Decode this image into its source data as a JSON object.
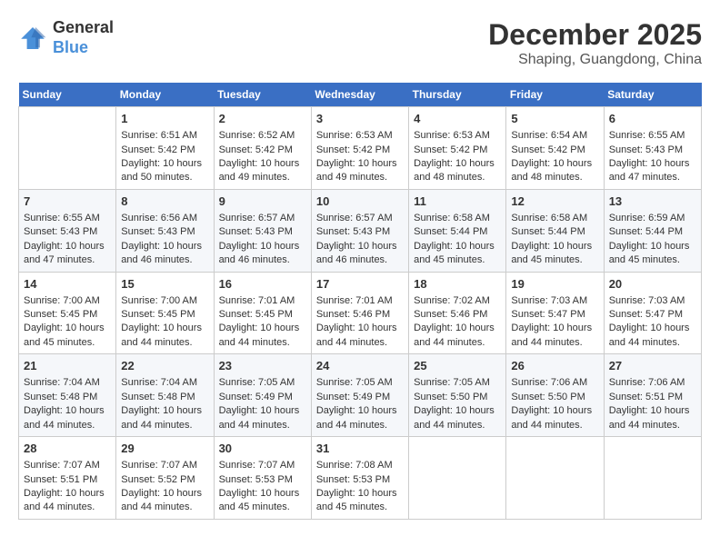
{
  "logo": {
    "line1": "General",
    "line2": "Blue"
  },
  "title": "December 2025",
  "subtitle": "Shaping, Guangdong, China",
  "days_header": [
    "Sunday",
    "Monday",
    "Tuesday",
    "Wednesday",
    "Thursday",
    "Friday",
    "Saturday"
  ],
  "weeks": [
    [
      {
        "day": "",
        "info": ""
      },
      {
        "day": "1",
        "info": "Sunrise: 6:51 AM\nSunset: 5:42 PM\nDaylight: 10 hours\nand 50 minutes."
      },
      {
        "day": "2",
        "info": "Sunrise: 6:52 AM\nSunset: 5:42 PM\nDaylight: 10 hours\nand 49 minutes."
      },
      {
        "day": "3",
        "info": "Sunrise: 6:53 AM\nSunset: 5:42 PM\nDaylight: 10 hours\nand 49 minutes."
      },
      {
        "day": "4",
        "info": "Sunrise: 6:53 AM\nSunset: 5:42 PM\nDaylight: 10 hours\nand 48 minutes."
      },
      {
        "day": "5",
        "info": "Sunrise: 6:54 AM\nSunset: 5:42 PM\nDaylight: 10 hours\nand 48 minutes."
      },
      {
        "day": "6",
        "info": "Sunrise: 6:55 AM\nSunset: 5:43 PM\nDaylight: 10 hours\nand 47 minutes."
      }
    ],
    [
      {
        "day": "7",
        "info": "Sunrise: 6:55 AM\nSunset: 5:43 PM\nDaylight: 10 hours\nand 47 minutes."
      },
      {
        "day": "8",
        "info": "Sunrise: 6:56 AM\nSunset: 5:43 PM\nDaylight: 10 hours\nand 46 minutes."
      },
      {
        "day": "9",
        "info": "Sunrise: 6:57 AM\nSunset: 5:43 PM\nDaylight: 10 hours\nand 46 minutes."
      },
      {
        "day": "10",
        "info": "Sunrise: 6:57 AM\nSunset: 5:43 PM\nDaylight: 10 hours\nand 46 minutes."
      },
      {
        "day": "11",
        "info": "Sunrise: 6:58 AM\nSunset: 5:44 PM\nDaylight: 10 hours\nand 45 minutes."
      },
      {
        "day": "12",
        "info": "Sunrise: 6:58 AM\nSunset: 5:44 PM\nDaylight: 10 hours\nand 45 minutes."
      },
      {
        "day": "13",
        "info": "Sunrise: 6:59 AM\nSunset: 5:44 PM\nDaylight: 10 hours\nand 45 minutes."
      }
    ],
    [
      {
        "day": "14",
        "info": "Sunrise: 7:00 AM\nSunset: 5:45 PM\nDaylight: 10 hours\nand 45 minutes."
      },
      {
        "day": "15",
        "info": "Sunrise: 7:00 AM\nSunset: 5:45 PM\nDaylight: 10 hours\nand 44 minutes."
      },
      {
        "day": "16",
        "info": "Sunrise: 7:01 AM\nSunset: 5:45 PM\nDaylight: 10 hours\nand 44 minutes."
      },
      {
        "day": "17",
        "info": "Sunrise: 7:01 AM\nSunset: 5:46 PM\nDaylight: 10 hours\nand 44 minutes."
      },
      {
        "day": "18",
        "info": "Sunrise: 7:02 AM\nSunset: 5:46 PM\nDaylight: 10 hours\nand 44 minutes."
      },
      {
        "day": "19",
        "info": "Sunrise: 7:03 AM\nSunset: 5:47 PM\nDaylight: 10 hours\nand 44 minutes."
      },
      {
        "day": "20",
        "info": "Sunrise: 7:03 AM\nSunset: 5:47 PM\nDaylight: 10 hours\nand 44 minutes."
      }
    ],
    [
      {
        "day": "21",
        "info": "Sunrise: 7:04 AM\nSunset: 5:48 PM\nDaylight: 10 hours\nand 44 minutes."
      },
      {
        "day": "22",
        "info": "Sunrise: 7:04 AM\nSunset: 5:48 PM\nDaylight: 10 hours\nand 44 minutes."
      },
      {
        "day": "23",
        "info": "Sunrise: 7:05 AM\nSunset: 5:49 PM\nDaylight: 10 hours\nand 44 minutes."
      },
      {
        "day": "24",
        "info": "Sunrise: 7:05 AM\nSunset: 5:49 PM\nDaylight: 10 hours\nand 44 minutes."
      },
      {
        "day": "25",
        "info": "Sunrise: 7:05 AM\nSunset: 5:50 PM\nDaylight: 10 hours\nand 44 minutes."
      },
      {
        "day": "26",
        "info": "Sunrise: 7:06 AM\nSunset: 5:50 PM\nDaylight: 10 hours\nand 44 minutes."
      },
      {
        "day": "27",
        "info": "Sunrise: 7:06 AM\nSunset: 5:51 PM\nDaylight: 10 hours\nand 44 minutes."
      }
    ],
    [
      {
        "day": "28",
        "info": "Sunrise: 7:07 AM\nSunset: 5:51 PM\nDaylight: 10 hours\nand 44 minutes."
      },
      {
        "day": "29",
        "info": "Sunrise: 7:07 AM\nSunset: 5:52 PM\nDaylight: 10 hours\nand 44 minutes."
      },
      {
        "day": "30",
        "info": "Sunrise: 7:07 AM\nSunset: 5:53 PM\nDaylight: 10 hours\nand 45 minutes."
      },
      {
        "day": "31",
        "info": "Sunrise: 7:08 AM\nSunset: 5:53 PM\nDaylight: 10 hours\nand 45 minutes."
      },
      {
        "day": "",
        "info": ""
      },
      {
        "day": "",
        "info": ""
      },
      {
        "day": "",
        "info": ""
      }
    ]
  ]
}
